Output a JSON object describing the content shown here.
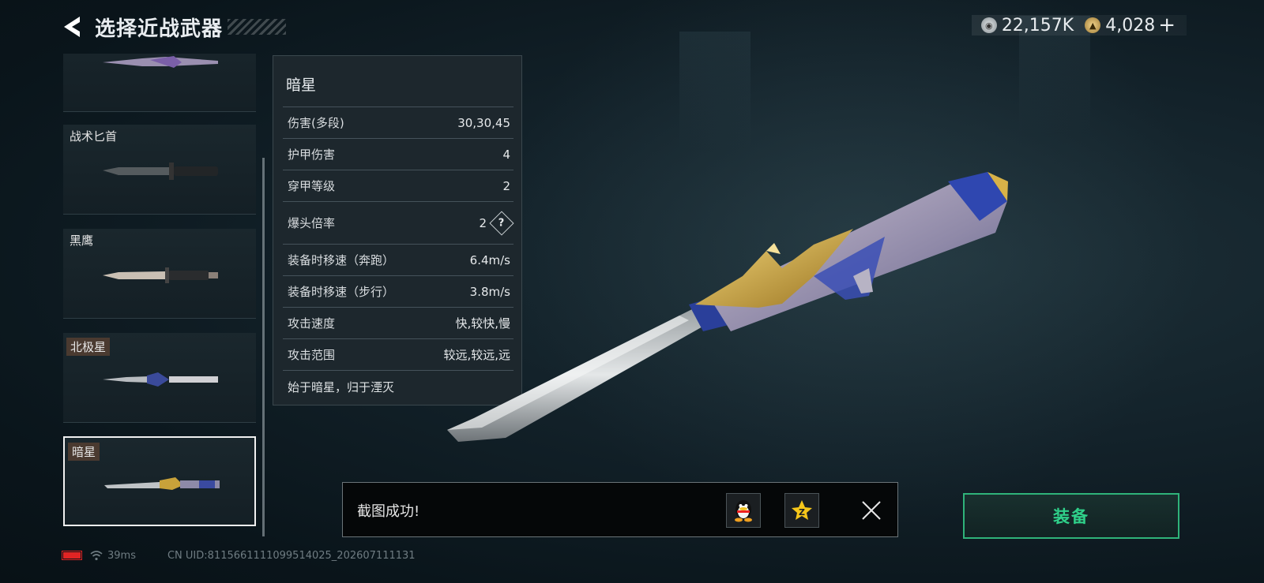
{
  "header": {
    "title": "选择近战武器"
  },
  "currency": [
    {
      "icon": "silver-coin-icon",
      "value": "22,157K",
      "color": "#b9c0c4"
    },
    {
      "icon": "gold-coin-icon",
      "value": "4,028",
      "color": "#d6b46a"
    }
  ],
  "currency_add": "+",
  "weapons": [
    {
      "name": "",
      "tagged": false
    },
    {
      "name": "战术匕首",
      "tagged": false
    },
    {
      "name": "黑鹰",
      "tagged": false
    },
    {
      "name": "北极星",
      "tagged": true
    },
    {
      "name": "暗星",
      "tagged": true,
      "selected": true
    }
  ],
  "info": {
    "title": "暗星",
    "rows": [
      {
        "label": "伤害(多段)",
        "value": "30,30,45"
      },
      {
        "label": "护甲伤害",
        "value": "4"
      },
      {
        "label": "穿甲等级",
        "value": "2"
      },
      {
        "label": "爆头倍率",
        "value": "2",
        "help": "?"
      },
      {
        "label": "装备时移速（奔跑）",
        "value": "6.4m/s"
      },
      {
        "label": "装备时移速（步行）",
        "value": "3.8m/s"
      },
      {
        "label": "攻击速度",
        "value": "快,较快,慢"
      },
      {
        "label": "攻击范围",
        "value": "较远,较远,远"
      }
    ],
    "description": "始于暗星，归于湮灭"
  },
  "toast": {
    "text": "截图成功!"
  },
  "equip": {
    "label": "装备"
  },
  "status": {
    "ping": "39ms",
    "uid": "CN UID:8115661111099514025_202607111131"
  },
  "colors": {
    "accent_green": "#2fd18a",
    "battery_low": "#e02424"
  }
}
